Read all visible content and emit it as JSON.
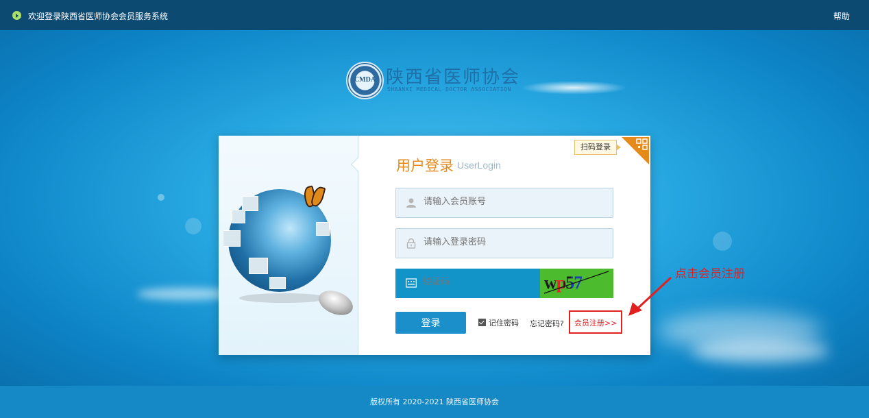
{
  "topbar": {
    "welcome": "欢迎登录陕西省医师协会会员服务系统",
    "help": "帮助"
  },
  "logo": {
    "seal_text": "CMDA",
    "name": "陕西省医师协会",
    "subtitle": "SHAANXI MEDICAL DOCTOR ASSOCIATION"
  },
  "login": {
    "title_cn": "用户登录",
    "title_en": "UserLogin",
    "qr_label": "扫码登录",
    "username_placeholder": "请输入会员账号",
    "password_placeholder": "请输入登录密码",
    "captcha_placeholder": "验证码",
    "captcha_text": "wp57",
    "login_button": "登录",
    "remember_label": "记住密码",
    "remember_checked": true,
    "forgot_label": "忘记密码?",
    "register_label": "会员注册>>"
  },
  "annotation": {
    "text": "点击会员注册"
  },
  "footer": {
    "copyright": "版权所有 2020-2021 陕西省医师协会"
  },
  "colors": {
    "accent_orange": "#e68a1c",
    "primary_blue": "#1a8fca",
    "annotation_red": "#e32020",
    "captcha_green": "#4cbc2e"
  }
}
